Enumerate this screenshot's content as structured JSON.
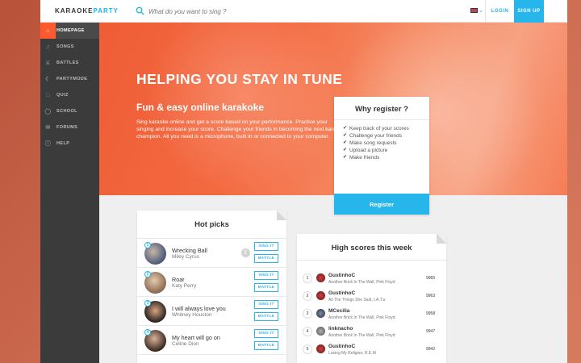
{
  "header": {
    "logo_main": "KARAOKE",
    "logo_accent": "PARTY",
    "search_placeholder": "What do you want to sing ?",
    "login_label": "LOGIN",
    "signup_label": "SIGN UP"
  },
  "sidebar": {
    "items": [
      {
        "label": "HOMEPAGE",
        "icon": "home-icon"
      },
      {
        "label": "SONGS",
        "icon": "music-icon"
      },
      {
        "label": "BATTLES",
        "icon": "battle-icon"
      },
      {
        "label": "PARTYMODE",
        "icon": "party-icon"
      },
      {
        "label": "QUIZ",
        "icon": "quiz-icon"
      },
      {
        "label": "SCHOOL",
        "icon": "school-icon"
      },
      {
        "label": "FORUMS",
        "icon": "forums-icon"
      },
      {
        "label": "HELP",
        "icon": "help-icon"
      }
    ]
  },
  "hero": {
    "title": "HELPING YOU STAY IN TUNE",
    "subtitle": "Fun & easy online karakoke",
    "description": "Sing karaoke online and get a score based on your performance. Practice your singing and increase your score. Challenge your friends in becoming the next karaoke champion. All you need is a microphone, built in or connected to your computer."
  },
  "why_register": {
    "title": "Why register ?",
    "items": [
      "Keep track of your scores",
      "Challenge your friends",
      "Make song requests",
      "Upload a picture",
      "Make friends"
    ],
    "button_label": "Register"
  },
  "hot_picks": {
    "title": "Hot picks",
    "sing_label": "SING IT",
    "battle_label": "BATTLE",
    "rows": [
      {
        "rank": "1",
        "song": "Wrecking Ball",
        "artist": "Miley Cyrus"
      },
      {
        "rank": "2",
        "song": "Roar",
        "artist": "Katy Perry"
      },
      {
        "rank": "3",
        "song": "I will always love you",
        "artist": "Whitney Houston"
      },
      {
        "rank": "4",
        "song": "My heart will go on",
        "artist": "Celine Dion"
      }
    ]
  },
  "high_scores": {
    "title": "High scores this week",
    "rows": [
      {
        "rank": "1",
        "name": "GustinhoC",
        "song": "Another Brick In The Wall, Pink Floyd",
        "score": "9965"
      },
      {
        "rank": "2",
        "name": "GustinhoC",
        "song": "All The Things She Said, t.A.T.u",
        "score": "9963"
      },
      {
        "rank": "3",
        "name": "MCecilia",
        "song": "Another Brick In The Wall, Pink Floyd",
        "score": "9958"
      },
      {
        "rank": "4",
        "name": "linknacho",
        "song": "Another Brick In The Wall, Pink Floyd",
        "score": "9947"
      },
      {
        "rank": "5",
        "name": "GustinhoC",
        "song": "Losing My Religion, R.E.M",
        "score": "9942"
      }
    ]
  },
  "colors": {
    "accent": "#26b6ec",
    "brand_orange": "#ff5a2e",
    "sidebar": "#3b3b3b"
  }
}
